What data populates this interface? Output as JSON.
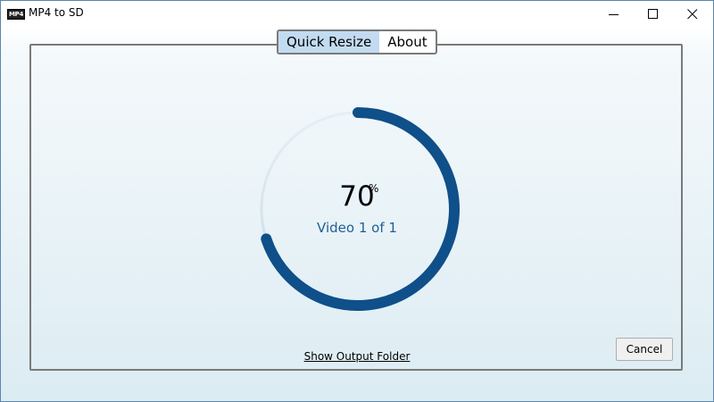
{
  "window": {
    "title": "MP4 to SD",
    "icon_label": "MP4",
    "icon": "app-icon",
    "controls": [
      "minimize-icon",
      "maximize-icon",
      "close-icon"
    ]
  },
  "tabs": [
    {
      "label": "Quick Resize",
      "active": true
    },
    {
      "label": "About",
      "active": false
    }
  ],
  "progress": {
    "percent_value": "70",
    "percent_sign": "%",
    "fraction": 0.7,
    "status": "Video 1 of 1",
    "ring_color": "#0f4f8a",
    "track_color": "#cfe3ee"
  },
  "actions": {
    "show_output_folder": "Show Output Folder",
    "cancel": "Cancel"
  }
}
